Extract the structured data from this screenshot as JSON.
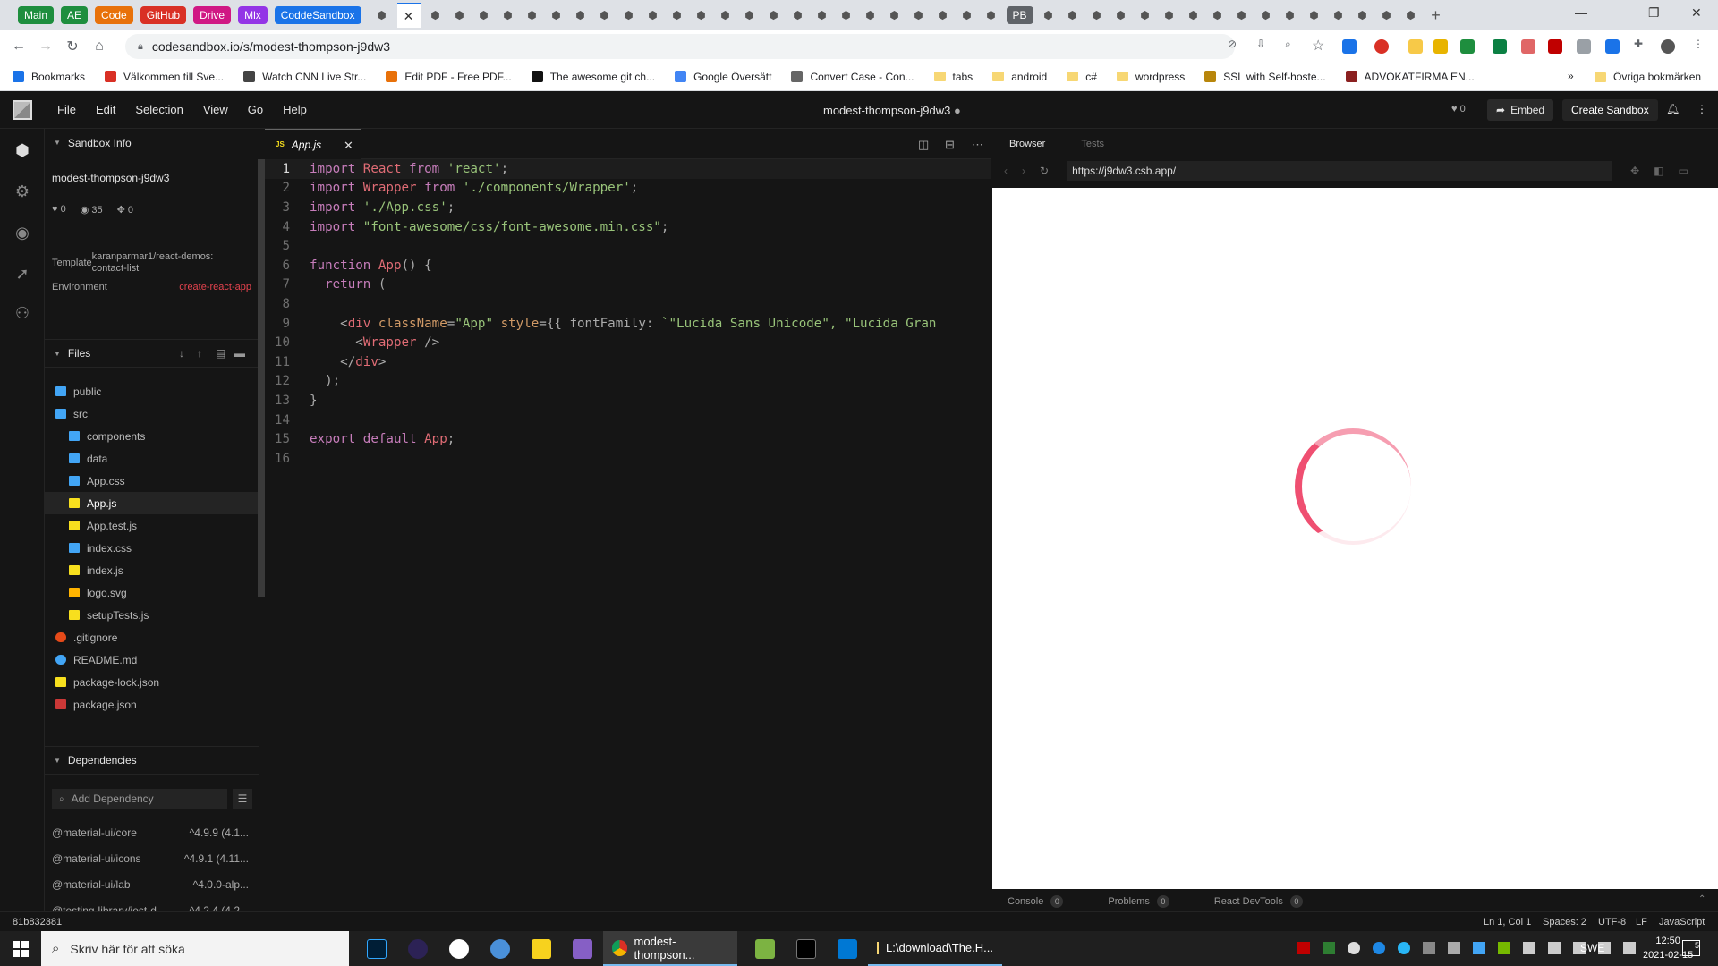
{
  "browser": {
    "tab_groups": [
      {
        "label": "Main",
        "color": "#1e8e3e"
      },
      {
        "label": "AE",
        "color": "#1e8e3e"
      },
      {
        "label": "Code",
        "color": "#e8710a"
      },
      {
        "label": "GitHub",
        "color": "#d93025"
      },
      {
        "label": "Drive",
        "color": "#d01884"
      },
      {
        "label": "Mlx",
        "color": "#9334e6"
      },
      {
        "label": "CoddeSandbox",
        "color": "#1a73e8"
      }
    ],
    "pb_group": "PB",
    "new_tab": "+",
    "url": "codesandbox.io/s/modest-thompson-j9dw3",
    "bookmarks": [
      {
        "label": "Bookmarks",
        "color": "#1a73e8"
      },
      {
        "label": "Välkommen till Sve...",
        "color": "#d93025"
      },
      {
        "label": "Watch CNN Live Str...",
        "color": "#444444"
      },
      {
        "label": "Edit PDF - Free PDF...",
        "color": "#e8710a"
      },
      {
        "label": "The awesome git ch...",
        "color": "#111111"
      },
      {
        "label": "Google Översätt",
        "color": "#4285f4"
      },
      {
        "label": "Convert Case - Con...",
        "color": "#666666"
      },
      {
        "label": "tabs",
        "folder": true
      },
      {
        "label": "android",
        "folder": true
      },
      {
        "label": "c#",
        "folder": true
      },
      {
        "label": "wordpress",
        "folder": true
      },
      {
        "label": "SSL with Self-hoste...",
        "color": "#b8860b"
      },
      {
        "label": "ADVOKATFIRMA EN...",
        "color": "#8b2020"
      }
    ],
    "bookmarks_more": "»",
    "other_bookmarks": "Övriga bokmärken"
  },
  "app": {
    "menu": [
      "File",
      "Edit",
      "Selection",
      "View",
      "Go",
      "Help"
    ],
    "title": "modest-thompson-j9dw3",
    "likes": "0",
    "embed_label": "Embed",
    "create_label": "Create Sandbox"
  },
  "sidebar": {
    "info_header": "Sandbox Info",
    "sandbox_name": "modest-thompson-j9dw3",
    "stats": {
      "likes": "0",
      "views": "35",
      "forks": "0"
    },
    "template_label": "Template",
    "template_value": "karanparmar1/react-demos: contact-list",
    "environment_label": "Environment",
    "environment_value": "create-react-app",
    "files_header": "Files",
    "files": [
      {
        "name": "public",
        "type": "folder",
        "depth": 0
      },
      {
        "name": "src",
        "type": "folder-open",
        "depth": 0
      },
      {
        "name": "components",
        "type": "folder",
        "depth": 1
      },
      {
        "name": "data",
        "type": "folder",
        "depth": 1
      },
      {
        "name": "App.css",
        "type": "css",
        "depth": 1
      },
      {
        "name": "App.js",
        "type": "js",
        "depth": 1,
        "active": true
      },
      {
        "name": "App.test.js",
        "type": "js",
        "depth": 1
      },
      {
        "name": "index.css",
        "type": "css",
        "depth": 1
      },
      {
        "name": "index.js",
        "type": "js",
        "depth": 1
      },
      {
        "name": "logo.svg",
        "type": "svg",
        "depth": 1
      },
      {
        "name": "setupTests.js",
        "type": "js",
        "depth": 1
      },
      {
        "name": ".gitignore",
        "type": "git",
        "depth": 0
      },
      {
        "name": "README.md",
        "type": "md",
        "depth": 0
      },
      {
        "name": "package-lock.json",
        "type": "json",
        "depth": 0
      },
      {
        "name": "package.json",
        "type": "npm",
        "depth": 0
      }
    ],
    "deps_header": "Dependencies",
    "add_dependency_placeholder": "Add Dependency",
    "dependencies": [
      {
        "name": "@material-ui/core",
        "version": "^4.9.9 (4.1..."
      },
      {
        "name": "@material-ui/icons",
        "version": "^4.9.1 (4.11..."
      },
      {
        "name": "@material-ui/lab",
        "version": "^4.0.0-alp..."
      },
      {
        "name": "@testing-library/jest-d...",
        "version": "^4.2.4 (4.2..."
      }
    ]
  },
  "editor": {
    "tab_label": "App.js",
    "tab_badge": "JS",
    "lines": [
      [
        [
          "kw",
          "import "
        ],
        [
          "id",
          "React "
        ],
        [
          "kw",
          "from "
        ],
        [
          "str",
          "'react'"
        ],
        [
          "pl",
          ";"
        ]
      ],
      [
        [
          "kw",
          "import "
        ],
        [
          "id",
          "Wrapper "
        ],
        [
          "kw",
          "from "
        ],
        [
          "str",
          "'./components/Wrapper'"
        ],
        [
          "pl",
          ";"
        ]
      ],
      [
        [
          "kw",
          "import "
        ],
        [
          "str",
          "'./App.css'"
        ],
        [
          "pl",
          ";"
        ]
      ],
      [
        [
          "kw",
          "import "
        ],
        [
          "str",
          "\"font-awesome/css/font-awesome.min.css\""
        ],
        [
          "pl",
          ";"
        ]
      ],
      [],
      [
        [
          "kw",
          "function "
        ],
        [
          "fn",
          "App"
        ],
        [
          "pl",
          "() {"
        ]
      ],
      [
        [
          "pl",
          "  "
        ],
        [
          "kw",
          "return "
        ],
        [
          "pl",
          "("
        ]
      ],
      [],
      [
        [
          "pl",
          "    <"
        ],
        [
          "tag",
          "div "
        ],
        [
          "attr",
          "className"
        ],
        [
          "pl",
          "="
        ],
        [
          "str",
          "\"App\" "
        ],
        [
          "attr",
          "style"
        ],
        [
          "pl",
          "={{ fontFamily: "
        ],
        [
          "str",
          "`\"Lucida Sans Unicode\", \"Lucida Gran"
        ]
      ],
      [
        [
          "pl",
          "      <"
        ],
        [
          "tag",
          "Wrapper "
        ],
        [
          "pl",
          "/>"
        ]
      ],
      [
        [
          "pl",
          "    </"
        ],
        [
          "tag",
          "div"
        ],
        [
          "pl",
          ">"
        ]
      ],
      [
        [
          "pl",
          "  );"
        ]
      ],
      [
        [
          "pl",
          "}"
        ]
      ],
      [],
      [
        [
          "kw",
          "export default "
        ],
        [
          "fn",
          "App"
        ],
        [
          "pl",
          ";"
        ]
      ],
      []
    ]
  },
  "preview": {
    "tabs": [
      "Browser",
      "Tests"
    ],
    "url": "https://j9dw3.csb.app/",
    "devtools": [
      {
        "label": "Console",
        "count": "0"
      },
      {
        "label": "Problems",
        "count": "0"
      },
      {
        "label": "React DevTools",
        "count": "0"
      }
    ]
  },
  "status": {
    "commit": "81b832381",
    "cursor": "Ln 1, Col 1",
    "spaces": "Spaces: 2",
    "encoding": "UTF-8",
    "eol": "LF",
    "language": "JavaScript"
  },
  "taskbar": {
    "search_placeholder": "Skriv här för att söka",
    "chrome_window": "modest-thompson...",
    "explorer_window": "L:\\download\\The.H...",
    "lang": "SWE",
    "time": "12:50",
    "date": "2021-02-15",
    "notif_count": "5"
  }
}
